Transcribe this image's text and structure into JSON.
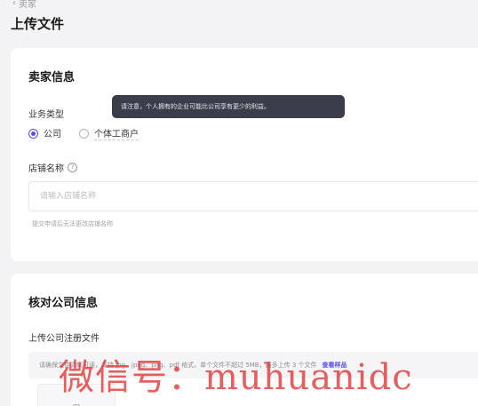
{
  "header": {
    "back_label": "卖家",
    "title": "上传文件"
  },
  "seller_info": {
    "title": "卖家信息",
    "business_type_label": "业务类型",
    "options": [
      "公司",
      "个体工商户"
    ],
    "selected_option": "公司",
    "tooltip": "请注意，个人拥有的企业可能比公司享有更少的利益。",
    "store_name_label": "店铺名称",
    "store_name_placeholder": "请输入店铺名称",
    "store_name_hint": "提交申请后无法更改店铺名称"
  },
  "company_info": {
    "title": "核对公司信息",
    "upload_label": "上传公司注册文件",
    "upload_hint": "请确保文件清晰可读，支持 jpg、jpeg、png、pdf 格式，单个文件不超过 5MB，最多上传 3 个文件",
    "view_sample": "查看样品",
    "upload_button": "图"
  },
  "watermark": "微信号：muhuanidc",
  "colors": {
    "accent": "#5b4cf0",
    "tooltip_bg": "#3b3e4a",
    "watermark": "#e23c3c"
  }
}
